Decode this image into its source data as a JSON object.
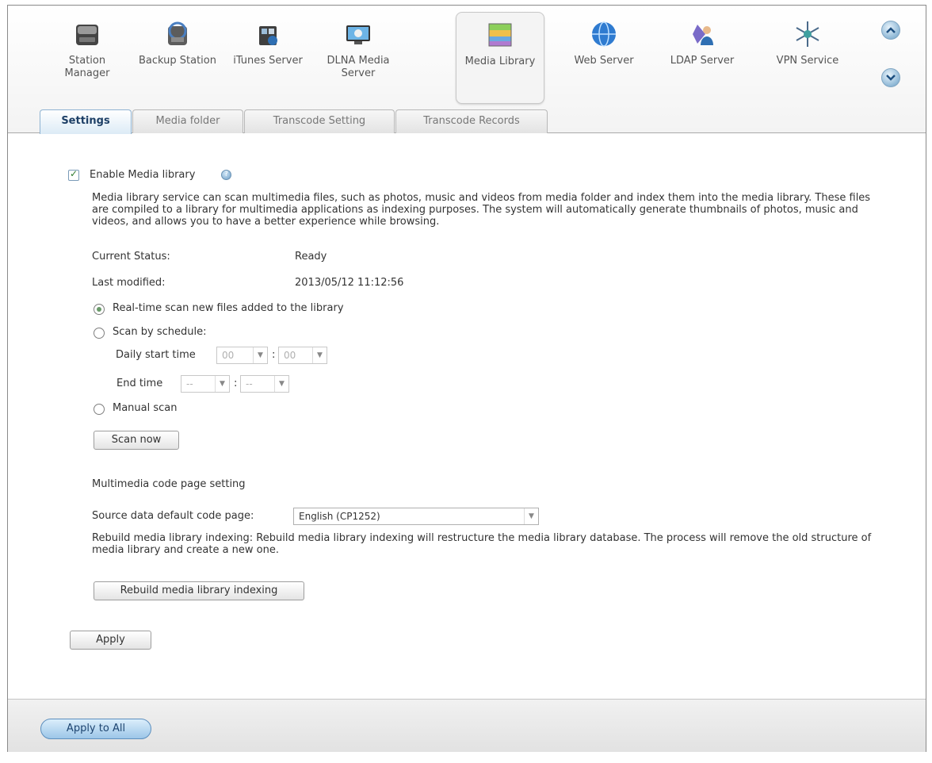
{
  "apps": [
    {
      "label": "Station Manager",
      "icon": "station-manager-icon"
    },
    {
      "label": "Backup Station",
      "icon": "backup-station-icon"
    },
    {
      "label": "iTunes Server",
      "icon": "itunes-server-icon"
    },
    {
      "label": "DLNA Media Server",
      "icon": "dlna-media-server-icon"
    },
    {
      "label": "Media Library",
      "icon": "media-library-icon"
    },
    {
      "label": "Web Server",
      "icon": "web-server-icon"
    },
    {
      "label": "LDAP Server",
      "icon": "ldap-server-icon"
    },
    {
      "label": "VPN Service",
      "icon": "vpn-service-icon"
    }
  ],
  "active_app": "Media Library",
  "tabs": [
    "Settings",
    "Media folder",
    "Transcode Setting",
    "Transcode Records"
  ],
  "active_tab": "Settings",
  "settings": {
    "enable_label": "Enable Media library",
    "enable_checked": true,
    "description": "Media library service can scan multimedia files, such as photos, music and videos from media folder and index them into the media library. These files are compiled to a library for multimedia applications as indexing purposes. The system will automatically generate thumbnails of photos, music and videos, and allows you to have a better experience while browsing.",
    "current_status_label": "Current Status:",
    "current_status_value": "Ready",
    "last_modified_label": "Last modified:",
    "last_modified_value": "2013/05/12 11:12:56",
    "scan_options": {
      "realtime": "Real-time scan new files added to the library",
      "schedule": "Scan by schedule:",
      "manual": "Manual scan"
    },
    "selected_scan": "realtime",
    "daily_start_label": "Daily start time",
    "start_hour": "00",
    "start_minute": "00",
    "end_time_label": "End time",
    "end_hour": "--",
    "end_minute": "--",
    "time_sep": ":",
    "scan_now": "Scan now",
    "codepage_heading": "Multimedia code page setting",
    "codepage_label": "Source data default code page:",
    "codepage_value": "English (CP1252)",
    "rebuild_desc": "Rebuild media library indexing: Rebuild media library indexing will restructure the media library database. The process will remove the old structure of media library and create a new one.",
    "rebuild_button": "Rebuild media library indexing",
    "apply_button": "Apply"
  },
  "footer": {
    "apply_all": "Apply to All"
  },
  "colors": {
    "accent": "#9cc6e8",
    "active_tab_text": "#1d3f66"
  }
}
